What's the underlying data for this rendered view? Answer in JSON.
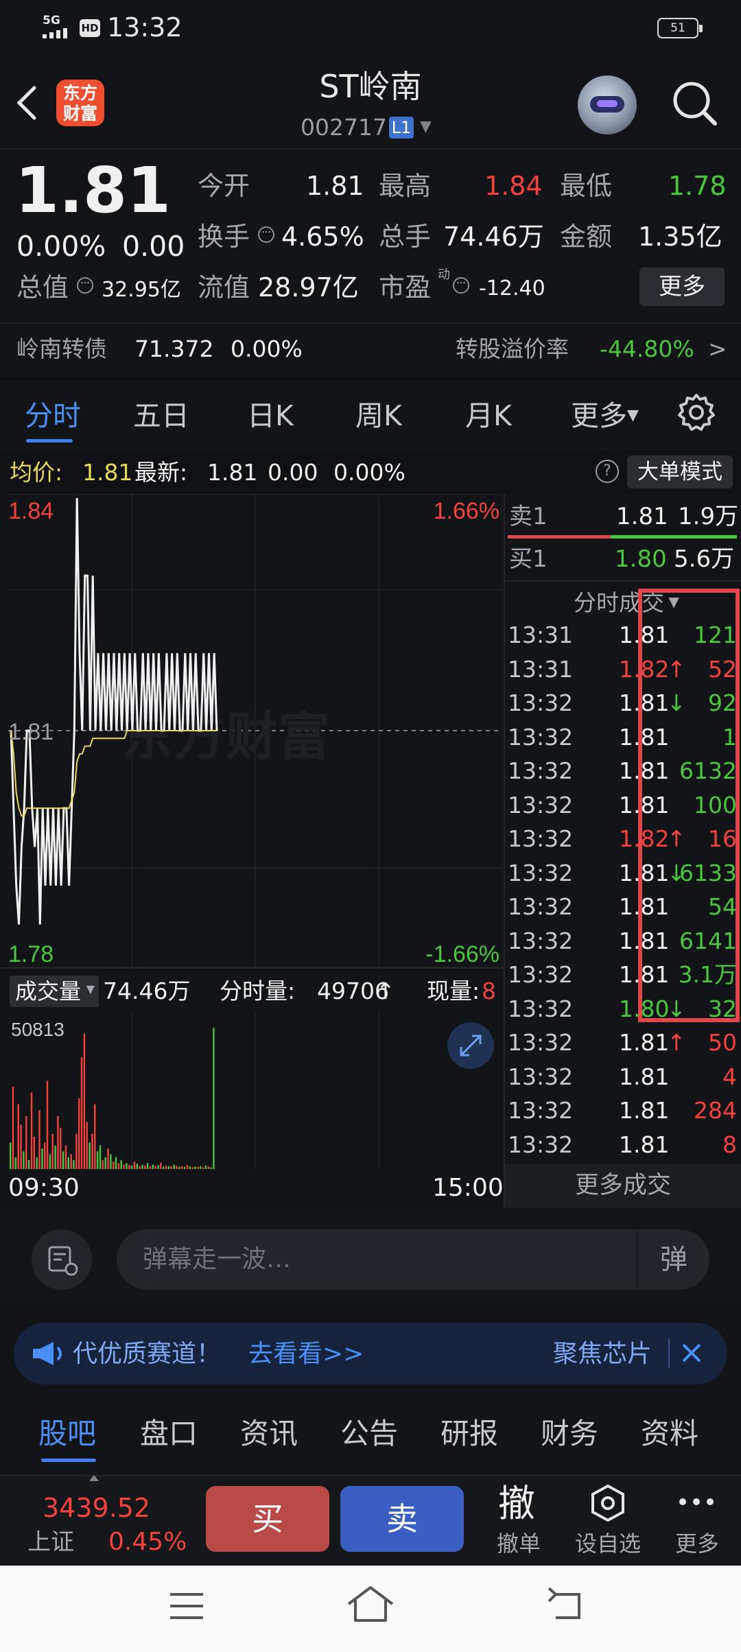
{
  "status_bar": {
    "network": "5G",
    "hd": "HD",
    "time": "13:32",
    "battery": "51"
  },
  "header": {
    "logo_line1": "东方",
    "logo_line2": "财富",
    "title": "ST岭南",
    "code": "002717",
    "level": "L1"
  },
  "quote": {
    "price": "1.81",
    "change_pct": "0.00%",
    "change": "0.00",
    "open_label": "今开",
    "open": "1.81",
    "high_label": "最高",
    "high": "1.84",
    "low_label": "最低",
    "low": "1.78",
    "turnover_label": "换手",
    "turnover": "4.65%",
    "volume_label": "总手",
    "volume": "74.46万",
    "amount_label": "金额",
    "amount": "1.35亿",
    "mktcap_label": "总值",
    "mktcap": "32.95亿",
    "float_label": "流值",
    "float": "28.97亿",
    "pe_label": "市盈",
    "pe_sup": "动",
    "pe": "-12.40",
    "more_label": "更多"
  },
  "convertible": {
    "name": "岭南转债",
    "price": "71.372",
    "pct": "0.00%",
    "premium_label": "转股溢价率",
    "premium": "-44.80%",
    "arrow": ">"
  },
  "tabs": [
    {
      "label": "分时"
    },
    {
      "label": "五日"
    },
    {
      "label": "日K"
    },
    {
      "label": "周K"
    },
    {
      "label": "月K"
    },
    {
      "label": "更多"
    }
  ],
  "avg_bar": {
    "avg_label": "均价:",
    "avg": "1.81",
    "last_label": "最新:",
    "last": "1.81",
    "chg": "0.00",
    "pct": "0.00%",
    "help": "?",
    "big_order": "大单模式"
  },
  "chart_labels": {
    "top_price": "1.84",
    "mid_price": "1.81",
    "bottom_price": "1.78",
    "top_pct": "1.66%",
    "bottom_pct": "-1.66%",
    "watermark": "东方财富"
  },
  "volume_bar": {
    "dropdown": "成交量",
    "total": "74.46万",
    "minute_label": "分时量:",
    "minute": "49706",
    "minute_arrow": "↑",
    "current_label": "现量:",
    "current": "8",
    "max": "50813"
  },
  "time_axis": {
    "start": "09:30",
    "end": "15:00"
  },
  "order_book": {
    "sell_label": "卖1",
    "sell_price": "1.81",
    "sell_vol": "1.9万",
    "buy_label": "买1",
    "buy_price": "1.80",
    "buy_vol": "5.6万"
  },
  "ticks_header": "分时成交",
  "ticks": [
    {
      "time": "13:31",
      "price": "1.81",
      "arrow": "",
      "vol": "121",
      "pc": "white",
      "vc": "green"
    },
    {
      "time": "13:31",
      "price": "1.82",
      "arrow": "↑",
      "vol": "52",
      "pc": "red",
      "vc": "red"
    },
    {
      "time": "13:32",
      "price": "1.81",
      "arrow": "↓",
      "vol": "92",
      "pc": "white",
      "vc": "green"
    },
    {
      "time": "13:32",
      "price": "1.81",
      "arrow": "",
      "vol": "1",
      "pc": "white",
      "vc": "green"
    },
    {
      "time": "13:32",
      "price": "1.81",
      "arrow": "",
      "vol": "6132",
      "pc": "white",
      "vc": "green"
    },
    {
      "time": "13:32",
      "price": "1.81",
      "arrow": "",
      "vol": "100",
      "pc": "white",
      "vc": "green"
    },
    {
      "time": "13:32",
      "price": "1.82",
      "arrow": "↑",
      "vol": "16",
      "pc": "red",
      "vc": "red"
    },
    {
      "time": "13:32",
      "price": "1.81",
      "arrow": "↓",
      "vol": "6133",
      "pc": "white",
      "vc": "green"
    },
    {
      "time": "13:32",
      "price": "1.81",
      "arrow": "",
      "vol": "54",
      "pc": "white",
      "vc": "green"
    },
    {
      "time": "13:32",
      "price": "1.81",
      "arrow": "",
      "vol": "6141",
      "pc": "white",
      "vc": "green"
    },
    {
      "time": "13:32",
      "price": "1.81",
      "arrow": "",
      "vol": "3.1万",
      "pc": "white",
      "vc": "green"
    },
    {
      "time": "13:32",
      "price": "1.80",
      "arrow": "↓",
      "vol": "32",
      "pc": "green",
      "vc": "green"
    },
    {
      "time": "13:32",
      "price": "1.81",
      "arrow": "↑",
      "vol": "50",
      "pc": "white",
      "vc": "red"
    },
    {
      "time": "13:32",
      "price": "1.81",
      "arrow": "",
      "vol": "4",
      "pc": "white",
      "vc": "red"
    },
    {
      "time": "13:32",
      "price": "1.81",
      "arrow": "",
      "vol": "284",
      "pc": "white",
      "vc": "red"
    },
    {
      "time": "13:32",
      "price": "1.81",
      "arrow": "",
      "vol": "8",
      "pc": "white",
      "vc": "red"
    }
  ],
  "more_trades": "更多成交",
  "danmu": {
    "placeholder": "弹幕走一波…",
    "button": "弹"
  },
  "banner": {
    "text": "代优质赛道！",
    "link": "去看看>>",
    "right": "聚焦芯片"
  },
  "bottom_tabs": [
    {
      "label": "股吧"
    },
    {
      "label": "盘口"
    },
    {
      "label": "资讯"
    },
    {
      "label": "公告"
    },
    {
      "label": "研报"
    },
    {
      "label": "财务"
    },
    {
      "label": "资料"
    }
  ],
  "action_bar": {
    "index_value": "3439.52",
    "index_name": "上证",
    "index_pct": "0.45%",
    "buy": "买",
    "sell": "卖",
    "cancel_glyph": "撤",
    "cancel": "撤单",
    "watch": "设自选",
    "more": "更多"
  },
  "colors": {
    "up": "#f2423e",
    "down": "#4cc540",
    "accent": "#4b8ff5",
    "avg_line": "#e8d85a",
    "highlight_box": "#e0474c"
  },
  "chart_data": [
    {
      "type": "line",
      "y_range": [
        1.78,
        1.84
      ],
      "pct_range": [
        "-1.66%",
        "1.66%"
      ],
      "x_range": [
        "09:30",
        "15:00"
      ],
      "series": [
        {
          "values": [
            1.81,
            1.8,
            1.79,
            1.785,
            1.795,
            1.8,
            1.81,
            1.81,
            1.8,
            1.795,
            1.8,
            1.785,
            1.8,
            1.79,
            1.8,
            1.79,
            1.8,
            1.79,
            1.8,
            1.79,
            1.8,
            1.8,
            1.79,
            1.8,
            1.81,
            1.84,
            1.82,
            1.81,
            1.83,
            1.83,
            1.81,
            1.83,
            1.81,
            1.82,
            1.81,
            1.82,
            1.81,
            1.82,
            1.81,
            1.82,
            1.81,
            1.82,
            1.81,
            1.82,
            1.81,
            1.82,
            1.81,
            1.82,
            1.81,
            1.81,
            1.82,
            1.81,
            1.82,
            1.81,
            1.82,
            1.81,
            1.82,
            1.81,
            1.81,
            1.82,
            1.81,
            1.82,
            1.81,
            1.82,
            1.81,
            1.81,
            1.82,
            1.81,
            1.82,
            1.81,
            1.82,
            1.81,
            1.81,
            1.82,
            1.81,
            1.82,
            1.81,
            1.82,
            1.81
          ]
        },
        {
          "values": [
            1.81,
            1.807,
            1.802,
            1.8,
            1.799,
            1.799,
            1.8,
            1.8,
            1.8,
            1.8,
            1.8,
            1.8,
            1.8,
            1.8,
            1.8,
            1.8,
            1.8,
            1.8,
            1.8,
            1.8,
            1.8,
            1.8,
            1.8,
            1.801,
            1.802,
            1.806,
            1.807,
            1.807,
            1.808,
            1.808,
            1.808,
            1.809,
            1.809,
            1.809,
            1.809,
            1.809,
            1.809,
            1.809,
            1.809,
            1.809,
            1.809,
            1.809,
            1.809,
            1.809,
            1.81,
            1.81,
            1.81,
            1.81,
            1.81,
            1.81,
            1.81,
            1.81,
            1.81,
            1.81,
            1.81,
            1.81,
            1.81,
            1.81,
            1.81,
            1.81,
            1.81,
            1.81,
            1.81,
            1.81,
            1.81,
            1.81,
            1.81,
            1.81,
            1.81,
            1.81,
            1.81,
            1.81,
            1.81,
            1.81,
            1.81,
            1.81,
            1.81,
            1.81,
            1.81
          ]
        }
      ]
    },
    {
      "type": "bar",
      "y_max": 50813,
      "values": [
        9000,
        28000,
        4000,
        22000,
        15000,
        6000,
        18000,
        3000,
        26000,
        11000,
        4000,
        20000,
        7000,
        9000,
        30000,
        5000,
        12000,
        8000,
        18000,
        14000,
        6000,
        8000,
        4000,
        5000,
        3000,
        12000,
        24000,
        38000,
        46000,
        16000,
        9000,
        12000,
        22000,
        6000,
        8000,
        3000,
        4000,
        7000,
        5000,
        2500,
        4000,
        2000,
        3000,
        1500,
        2000,
        1500,
        1200,
        2500,
        1800,
        1000,
        1500,
        1200,
        2000,
        900,
        1500,
        1000,
        1300,
        2200,
        800,
        1200,
        1000,
        900,
        1500,
        1100,
        800,
        1000,
        700,
        1300,
        900,
        600,
        800,
        700,
        1000,
        600,
        1200,
        900,
        600,
        48000
      ],
      "colors": [
        "g",
        "r",
        "g",
        "r",
        "r",
        "g",
        "r",
        "g",
        "r",
        "r",
        "g",
        "r",
        "g",
        "r",
        "r",
        "g",
        "r",
        "g",
        "r",
        "r",
        "g",
        "r",
        "g",
        "r",
        "g",
        "r",
        "r",
        "r",
        "r",
        "r",
        "g",
        "r",
        "r",
        "g",
        "g",
        "r",
        "g",
        "r",
        "g",
        "r",
        "g",
        "r",
        "g",
        "r",
        "g",
        "r",
        "g",
        "r",
        "g",
        "r",
        "g",
        "r",
        "g",
        "r",
        "g",
        "r",
        "g",
        "r",
        "g",
        "r",
        "g",
        "r",
        "g",
        "r",
        "g",
        "r",
        "g",
        "r",
        "g",
        "r",
        "g",
        "r",
        "g",
        "r",
        "g",
        "r",
        "g",
        "g"
      ]
    }
  ]
}
